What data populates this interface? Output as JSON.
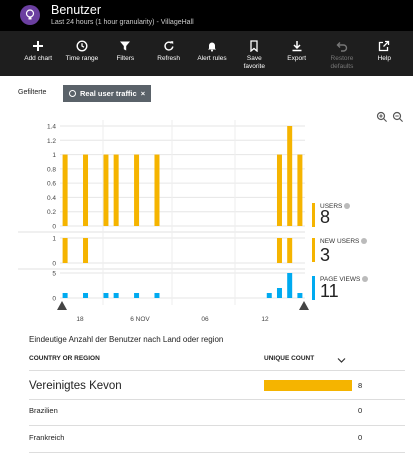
{
  "header": {
    "title": "Benutzer",
    "subtitle": "Last 24 hours (1 hour granularity) - VillageHall",
    "icon": "bulb-icon"
  },
  "toolbar": {
    "items": [
      {
        "label": "Add chart",
        "icon": "plus-icon",
        "enabled": true
      },
      {
        "label": "Time range",
        "icon": "clock-icon",
        "enabled": true
      },
      {
        "label": "Filters",
        "icon": "funnel-icon",
        "enabled": true
      },
      {
        "label": "Refresh",
        "icon": "refresh-icon",
        "enabled": true
      },
      {
        "label": "Alert rules",
        "icon": "bell-icon",
        "enabled": true
      },
      {
        "label": "Save favorite",
        "icon": "bookmark-icon",
        "enabled": true
      },
      {
        "label": "Export",
        "icon": "download-icon",
        "enabled": true
      },
      {
        "label": "Restore defaults",
        "icon": "undo-icon",
        "enabled": false
      },
      {
        "label": "Help",
        "icon": "external-link-icon",
        "enabled": true
      }
    ]
  },
  "filters": {
    "label": "Gefilterte",
    "chip": "Real user traffic",
    "chip_close": "×"
  },
  "chart_data": {
    "type": "bar",
    "x_ticks": [
      "18",
      "6 NOV",
      "06",
      "12"
    ],
    "series": [
      {
        "name": "USERS",
        "value": "8",
        "color": "#f5b400",
        "y_ticks": [
          "1.4",
          "1.2",
          "1",
          "0.8",
          "0.6",
          "0.4",
          "0.2",
          "0"
        ],
        "ylim": [
          0,
          1.4
        ],
        "values": [
          1,
          0,
          1,
          0,
          1,
          1,
          0,
          1,
          0,
          1,
          0,
          0,
          0,
          0,
          0,
          0,
          0,
          0,
          0,
          0,
          0,
          1,
          1.4,
          1
        ]
      },
      {
        "name": "NEW USERS",
        "value": "3",
        "color": "#f5b400",
        "y_ticks": [
          "1",
          "0"
        ],
        "ylim": [
          0,
          1
        ],
        "values": [
          1,
          0,
          1,
          0,
          0,
          0,
          0,
          0,
          0,
          0,
          0,
          0,
          0,
          0,
          0,
          0,
          0,
          0,
          0,
          0,
          0,
          1,
          1,
          0
        ]
      },
      {
        "name": "PAGE VIEWS",
        "value": "11",
        "color": "#00aaf0",
        "y_ticks": [
          "5",
          "0"
        ],
        "ylim": [
          0,
          5
        ],
        "values": [
          1,
          0,
          1,
          0,
          1,
          1,
          0,
          1,
          0,
          1,
          0,
          0,
          0,
          0,
          0,
          0,
          0,
          0,
          0,
          0,
          1,
          2,
          5,
          1
        ]
      }
    ]
  },
  "table": {
    "title": "Eindeutige Anzahl der Benutzer nach Land oder region",
    "columns": [
      "COUNTRY OR REGION",
      "UNIQUE COUNT"
    ],
    "sort_icon": "chevron-down-icon",
    "max": 8,
    "rows": [
      {
        "country": "Vereinigtes Kevon",
        "count": 8
      },
      {
        "country": "Brazilien",
        "count": 0
      },
      {
        "country": "Frankreich",
        "count": 0
      }
    ]
  },
  "zoom": {
    "in_icon": "zoom-in-icon",
    "out_icon": "zoom-out-icon"
  }
}
